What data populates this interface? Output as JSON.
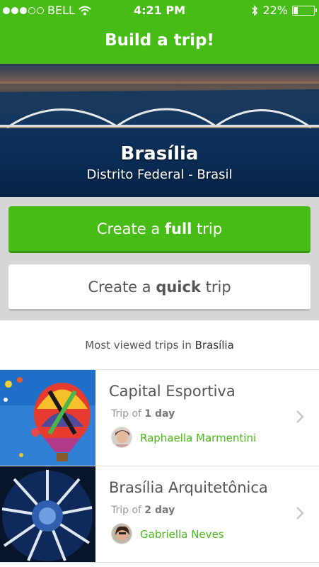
{
  "status_bar": {
    "carrier": "BELL",
    "time": "4:21 PM",
    "battery": "22%",
    "battery_level": 0.22,
    "signal_bars_filled": 3,
    "signal_bars_total": 5,
    "icons": [
      "wifi-icon",
      "bluetooth-icon",
      "battery-icon"
    ]
  },
  "header": {
    "title": "Build a trip!"
  },
  "hero": {
    "city": "Brasília",
    "region": "Distrito Federal - Brasil"
  },
  "actions": {
    "full": {
      "prefix": "Create a ",
      "bold": "full",
      "suffix": " trip"
    },
    "quick": {
      "prefix": "Create a ",
      "bold": "quick",
      "suffix": " trip"
    }
  },
  "most_viewed": {
    "label": "Most viewed trips in ",
    "city": "Brasília"
  },
  "trips": [
    {
      "name": "Capital Esportiva",
      "duration_prefix": "Trip of ",
      "duration": "1 day",
      "author": "Raphaella Marmentini"
    },
    {
      "name": "Brasília Arquitetônica",
      "duration_prefix": "Trip of ",
      "duration": "2 day",
      "author": "Gabriella Neves"
    }
  ],
  "colors": {
    "brand_green": "#47bb16",
    "button_shadow": "#35950c",
    "panel_gray": "#d6d6d6"
  }
}
